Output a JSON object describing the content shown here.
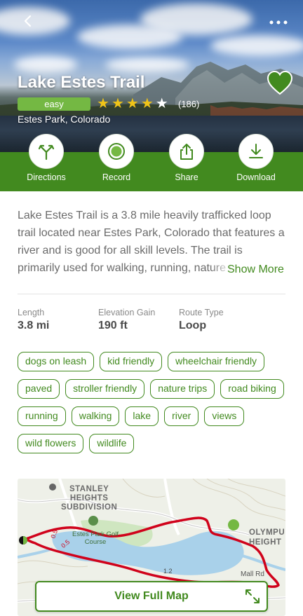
{
  "trail": {
    "title": "Lake Estes Trail",
    "difficulty": "easy",
    "rating": 4,
    "rating_max": 5,
    "rating_count": "(186)",
    "location": "Estes Park, Colorado"
  },
  "actions": [
    {
      "label": "Directions",
      "icon": "directions-icon"
    },
    {
      "label": "Record",
      "icon": "record-icon"
    },
    {
      "label": "Share",
      "icon": "share-icon"
    },
    {
      "label": "Download",
      "icon": "download-icon"
    }
  ],
  "description": {
    "text": "Lake Estes Trail is a 3.8 mile heavily trafficked loop trail located near Estes Park, Colorado that features a river and is good for all skill levels. The trail is primarily used for walking, running, nature trips",
    "show_more": "Show More"
  },
  "stats": {
    "length_label": "Length",
    "length_value": "3.8 mi",
    "elevation_label": "Elevation Gain",
    "elevation_value": "190 ft",
    "route_label": "Route Type",
    "route_value": "Loop"
  },
  "tags": [
    "dogs on leash",
    "kid friendly",
    "wheelchair friendly",
    "paved",
    "stroller friendly",
    "nature trips",
    "road biking",
    "running",
    "walking",
    "lake",
    "river",
    "views",
    "wild flowers",
    "wildlife"
  ],
  "map": {
    "labels": {
      "subdivision_1": "STANLEY",
      "subdivision_2": "HEIGHTS",
      "subdivision_3": "SUBDIVISION",
      "golf_1": "Estes Park Golf",
      "golf_2": "Course",
      "olympus_1": "OLYMPU",
      "olympus_2": "HEIGHT",
      "mall_rd": "Mall Rd",
      "mile_05a": "0.5",
      "mile_05b": "0.5",
      "mile_12": "1.2"
    },
    "button": "View Full Map"
  },
  "colors": {
    "brand_green": "#428a1f",
    "easy_badge": "#74b843",
    "star": "#f0c419",
    "route": "#d0021b"
  }
}
